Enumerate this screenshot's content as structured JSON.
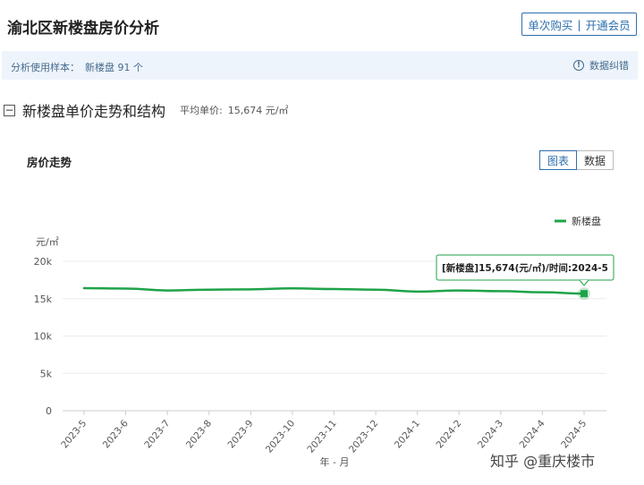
{
  "header": {
    "title": "渝北区新楼盘房价分析",
    "member_btn": {
      "single": "单次购买",
      "sep": "|",
      "member": "开通会员"
    }
  },
  "info_bar": {
    "sample_label": "分析使用样本：",
    "sample_value": "新楼盘 91 个",
    "feedback_icon": "info-icon",
    "feedback_glyph": "!",
    "feedback": "数据纠错"
  },
  "section": {
    "toggle_glyph": "−",
    "title": "新楼盘单价走势和结构",
    "avg_label": "平均单价:",
    "avg_value": "15,674 元/㎡"
  },
  "chart_panel": {
    "title": "房价走势",
    "tabs": [
      {
        "label": "图表",
        "active": true
      },
      {
        "label": "数据",
        "active": false
      }
    ]
  },
  "chart_data": {
    "type": "line",
    "x": [
      "2023-5",
      "2023-6",
      "2023-7",
      "2023-8",
      "2023-9",
      "2023-10",
      "2023-11",
      "2023-12",
      "2024-1",
      "2024-2",
      "2024-3",
      "2024-4",
      "2024-5"
    ],
    "series": [
      {
        "name": "新楼盘",
        "color": "#1fa34a",
        "values": [
          16400,
          16350,
          16100,
          16200,
          16250,
          16380,
          16280,
          16200,
          15950,
          16100,
          16000,
          15850,
          15674
        ]
      }
    ],
    "yticks": [
      "0",
      "5k",
      "10k",
      "15k",
      "20k"
    ],
    "ylim": [
      0,
      20000
    ],
    "ylabel": "元/㎡",
    "xlabel": "年 - 月",
    "legend_position": "top-right",
    "tooltip": "[新楼盘]15,674(元/㎡)/时间:2024-5"
  },
  "watermark": "知乎 @重庆楼市"
}
